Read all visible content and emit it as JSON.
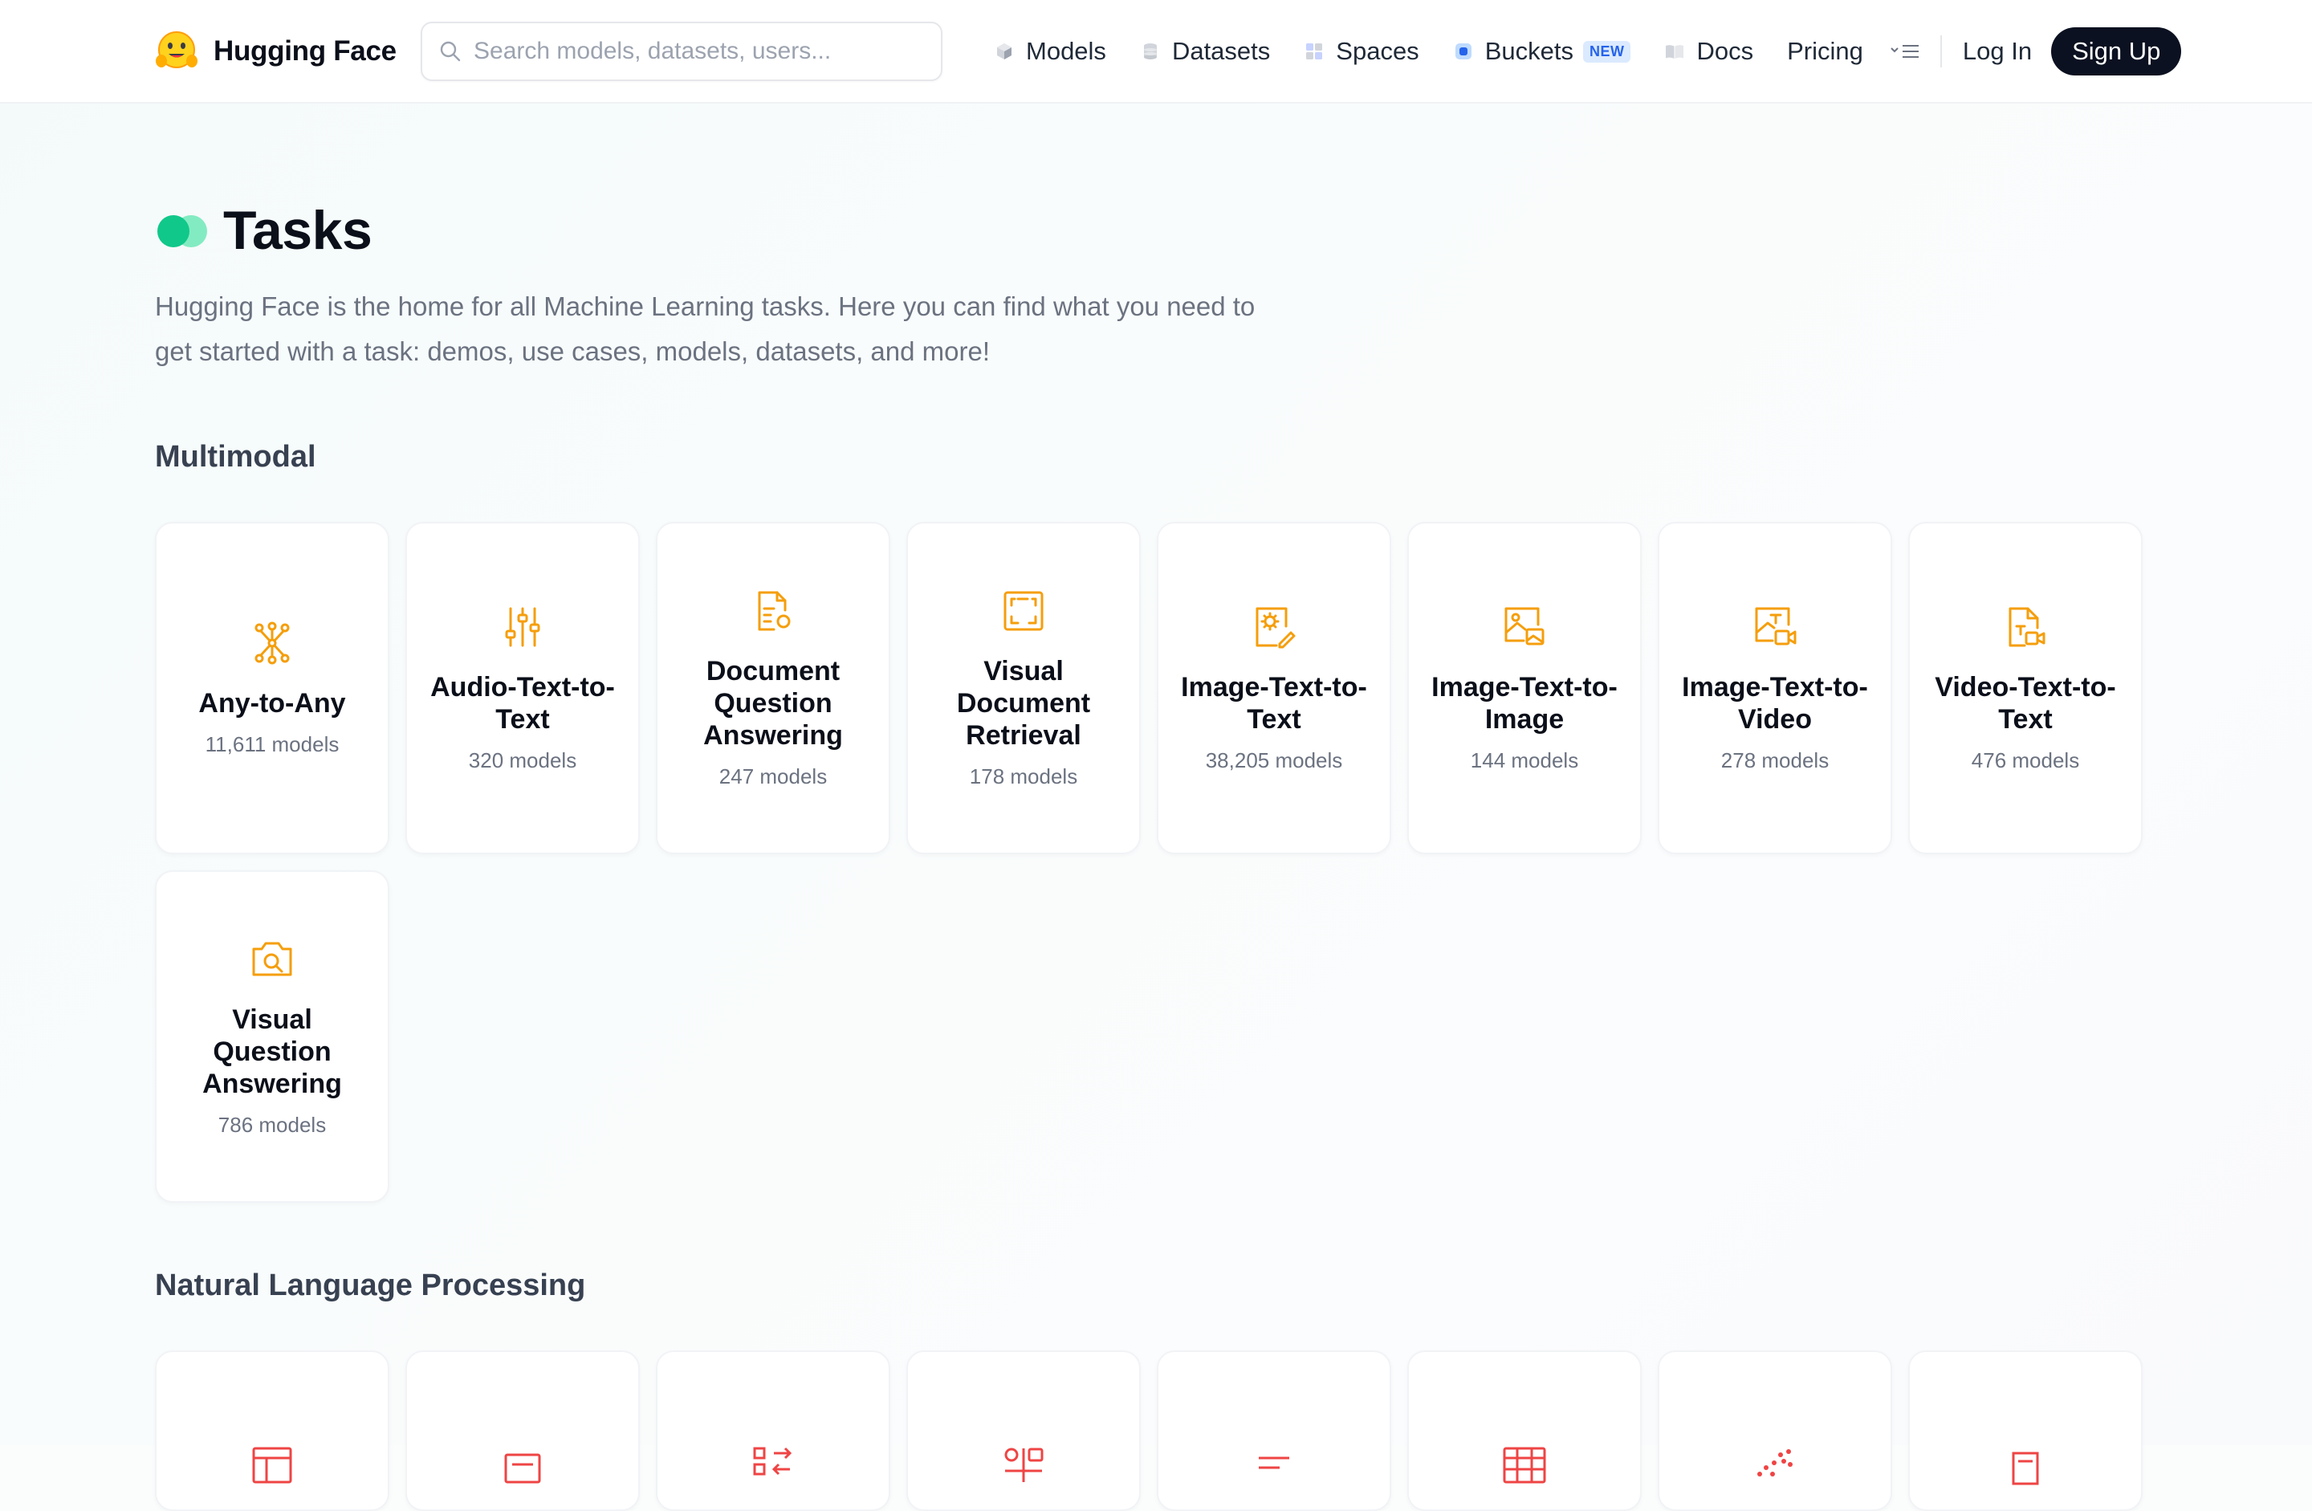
{
  "header": {
    "brand": "Hugging Face",
    "search_placeholder": "Search models, datasets, users...",
    "nav": [
      {
        "label": "Models",
        "icon": "cube-icon"
      },
      {
        "label": "Datasets",
        "icon": "database-icon"
      },
      {
        "label": "Spaces",
        "icon": "grid-icon"
      },
      {
        "label": "Buckets",
        "icon": "bucket-icon",
        "badge": "NEW"
      },
      {
        "label": "Docs",
        "icon": "book-icon"
      },
      {
        "label": "Pricing"
      }
    ],
    "login": "Log In",
    "signup": "Sign Up"
  },
  "page": {
    "title": "Tasks",
    "intro": "Hugging Face is the home for all Machine Learning tasks. Here you can find what you need to get started with a task: demos, use cases, models, datasets, and more!"
  },
  "sections": [
    {
      "title": "Multimodal",
      "color": "#f5a623",
      "tasks": [
        {
          "name": "Any-to-Any",
          "count": "11,611 models",
          "icon": "network-icon"
        },
        {
          "name": "Audio-Text-to-Text",
          "count": "320 models",
          "icon": "sliders-icon"
        },
        {
          "name": "Document Question Answering",
          "count": "247 models",
          "icon": "document-search-icon"
        },
        {
          "name": "Visual Document Retrieval",
          "count": "178 models",
          "icon": "frame-icon"
        },
        {
          "name": "Image-Text-to-Text",
          "count": "38,205 models",
          "icon": "image-edit-icon"
        },
        {
          "name": "Image-Text-to-Image",
          "count": "144 models",
          "icon": "image-image-icon"
        },
        {
          "name": "Image-Text-to-Video",
          "count": "278 models",
          "icon": "image-video-icon"
        },
        {
          "name": "Video-Text-to-Text",
          "count": "476 models",
          "icon": "file-video-icon"
        },
        {
          "name": "Visual Question Answering",
          "count": "786 models",
          "icon": "camera-search-icon"
        }
      ]
    },
    {
      "title": "Natural Language Processing",
      "color": "#ef4444",
      "tasks": [
        {
          "icon": "table-icon"
        },
        {
          "icon": "text-box-icon"
        },
        {
          "icon": "swap-icon"
        },
        {
          "icon": "token-icon"
        },
        {
          "icon": "lines-icon"
        },
        {
          "icon": "table-grid-icon"
        },
        {
          "icon": "scatter-icon"
        },
        {
          "icon": "doc-icon"
        }
      ]
    }
  ]
}
